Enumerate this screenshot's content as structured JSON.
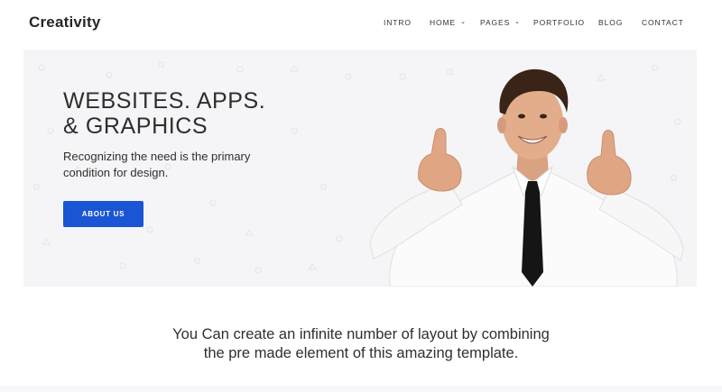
{
  "brand": {
    "logo": "Creativity"
  },
  "nav": {
    "intro": "INTRO",
    "home": "HOME",
    "pages": "PAGES",
    "portfolio": "PORTFOLIO",
    "blog": "BLOG",
    "contact": "CONTACT"
  },
  "hero": {
    "title_line1": "WEBSITES. APPS.",
    "title_line2": "& GRAPHICS",
    "subtitle": "Recognizing the need is the primary condition for design.",
    "button_label": "ABOUT US",
    "image_alt": "smiling man giving two thumbs up"
  },
  "intro": {
    "line1": "You Can create an infinite number of layout by combining",
    "line2": "the pre made element of this amazing template."
  },
  "colors": {
    "accent": "#1a55d4",
    "hero_bg": "#f5f5f7",
    "text": "#2b2b2b"
  }
}
